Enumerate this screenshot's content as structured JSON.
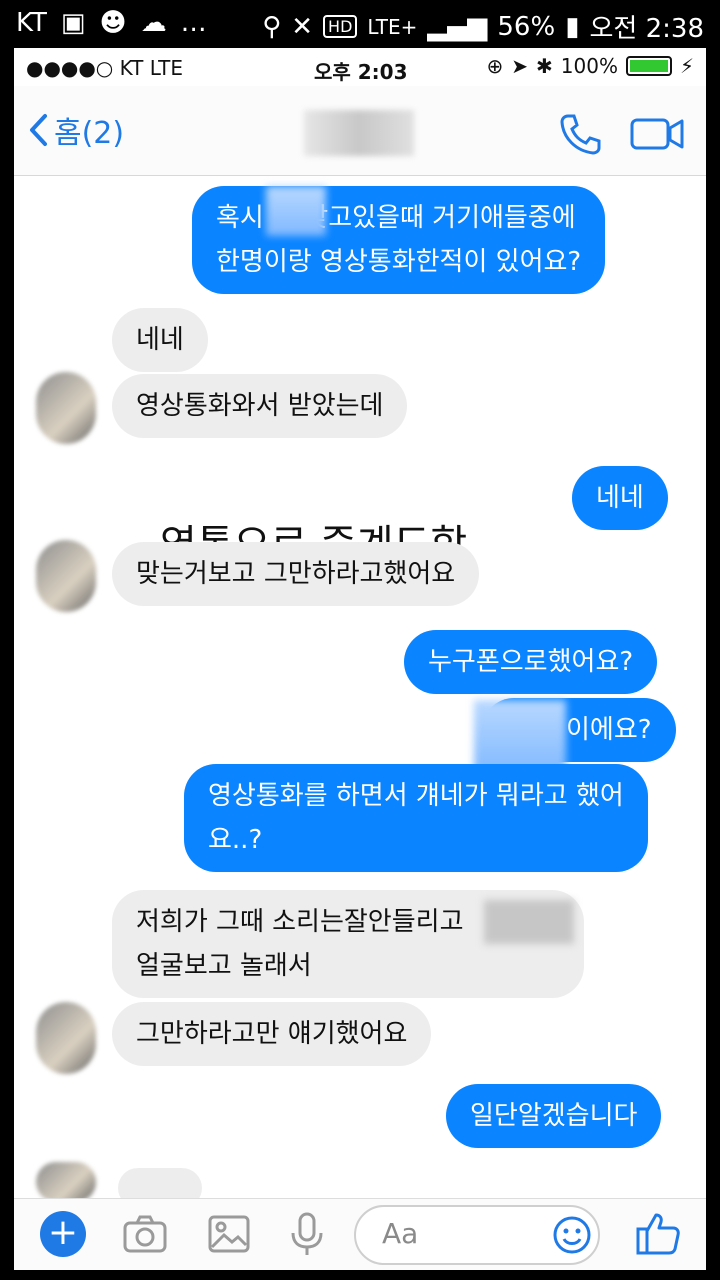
{
  "android_status": {
    "carrier": "KT",
    "battery": "56%",
    "network": "LTE+",
    "time": "오전 2:38"
  },
  "ios_status": {
    "carrier": "●●●●○ KT  LTE",
    "time": "오후 2:03",
    "battery": "100%"
  },
  "nav": {
    "back_label": "홈(2)"
  },
  "messages": [
    {
      "text_line1": "혹시       이 맞고있을때 거기애들중에",
      "text_line2": "한명이랑 영상통화한적이 있어요?"
    },
    {
      "text": "네네"
    },
    {
      "text": "영상통화와서 받았는데"
    },
    {
      "text": "네네"
    },
    {
      "text": "맞는거보고 그만하라고했어요"
    },
    {
      "text": "누구폰으로했어요?"
    },
    {
      "text": "이에요?"
    },
    {
      "text_line1": "영상통화를 하면서 걔네가 뭐라고 했어",
      "text_line2": "요..?"
    },
    {
      "text_line1": "저희가 그때 소리는잘안들리고",
      "text_line2": "얼굴보고 놀래서"
    },
    {
      "text": "그만하라고만 얘기했어요"
    },
    {
      "text": "일단알겠습니다"
    }
  ],
  "caption": "영통으로 중계도함",
  "composer": {
    "placeholder": "Aa"
  },
  "colors": {
    "accent": "#0a84ff",
    "incoming": "#ededed"
  }
}
